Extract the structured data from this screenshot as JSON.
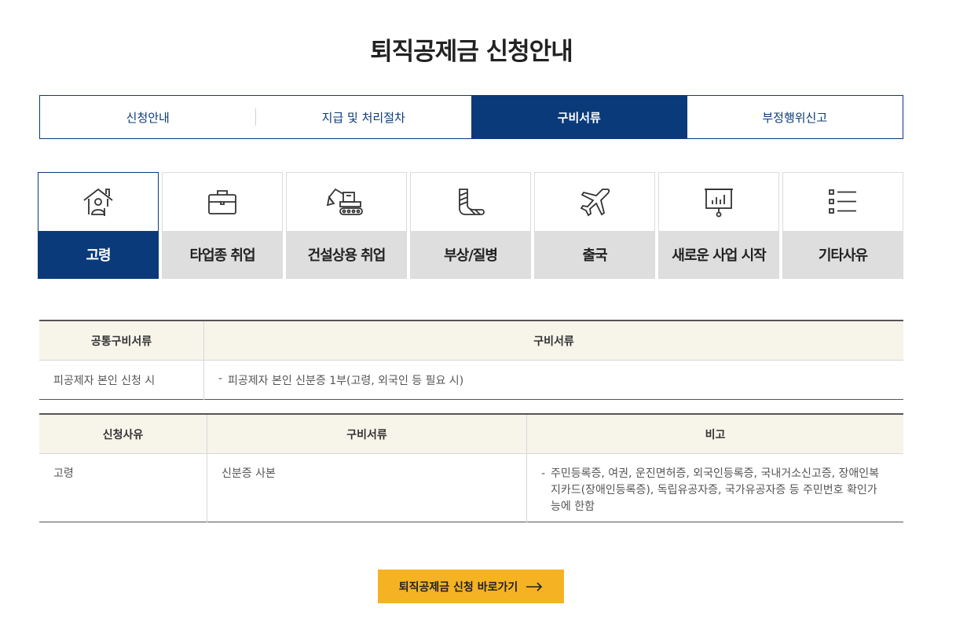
{
  "page_title": "퇴직공제금 신청안내",
  "main_tabs": [
    {
      "label": "신청안내"
    },
    {
      "label": "지급 및 처리절차"
    },
    {
      "label": "구비서류"
    },
    {
      "label": "부정행위신고"
    }
  ],
  "reasons": [
    {
      "label": "고령",
      "icon": "elderly-house-icon"
    },
    {
      "label": "타업종 취업",
      "icon": "briefcase-icon"
    },
    {
      "label": "건설상용 취업",
      "icon": "excavator-icon"
    },
    {
      "label": "부상/질병",
      "icon": "cast-injury-icon"
    },
    {
      "label": "출국",
      "icon": "airplane-icon"
    },
    {
      "label": "새로운 사업 시작",
      "icon": "presentation-board-icon"
    },
    {
      "label": "기타사유",
      "icon": "list-icon"
    }
  ],
  "common_table": {
    "headers": [
      "공통구비서류",
      "구비서류"
    ],
    "rows": [
      {
        "case": "피공제자 본인 신청 시",
        "docs": "피공제자 본인 신분증 1부(고령, 외국인 등 필요 시)"
      }
    ]
  },
  "reason_table": {
    "headers": [
      "신청사유",
      "구비서류",
      "비고"
    ],
    "rows": [
      {
        "reason": "고령",
        "docs": "신분증 사본",
        "note": "주민등록증, 여권, 운진면허증, 외국인등록증, 국내거소신고증, 장애인복지카드(장애인등록증), 독립유공자증, 국가유공자증 등 주민번호 확인가능에 한함"
      }
    ]
  },
  "apply_button": {
    "label": "퇴직공제금 신청 바로가기",
    "icon": "arrow-right-icon"
  },
  "colors": {
    "primary": "#0a3a7a",
    "accent": "#f5b323",
    "header_bg": "#f7f4ea",
    "inactive_tab_bg": "#dedede"
  }
}
